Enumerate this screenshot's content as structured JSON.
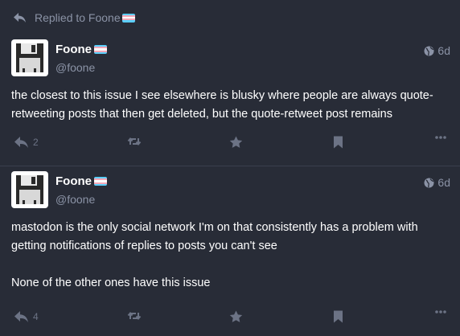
{
  "replied_to": {
    "label": "Replied to Foone",
    "icon": "reply-icon"
  },
  "colors": {
    "background": "#282c37",
    "muted": "#8b93a6",
    "action_icon": "#6c7385",
    "flag_blue": "#5bcefa",
    "flag_pink": "#f5a9b8",
    "flag_white": "#ffffff"
  },
  "posts": [
    {
      "display_name": "Foone",
      "handle": "@foone",
      "time": "6d",
      "visibility_icon": "globe-icon",
      "paragraphs": [
        "the closest to this issue I see elsewhere is blusky where people are always quote-retweeting posts that then get deleted, but the quote-retweet post remains"
      ],
      "reply_count": "2"
    },
    {
      "display_name": "Foone",
      "handle": "@foone",
      "time": "6d",
      "visibility_icon": "globe-icon",
      "paragraphs": [
        "mastodon is the only social network I'm on that consistently has a problem with getting notifications of replies to posts you can't see",
        "None of the other ones have this issue"
      ],
      "reply_count": "4"
    }
  ]
}
